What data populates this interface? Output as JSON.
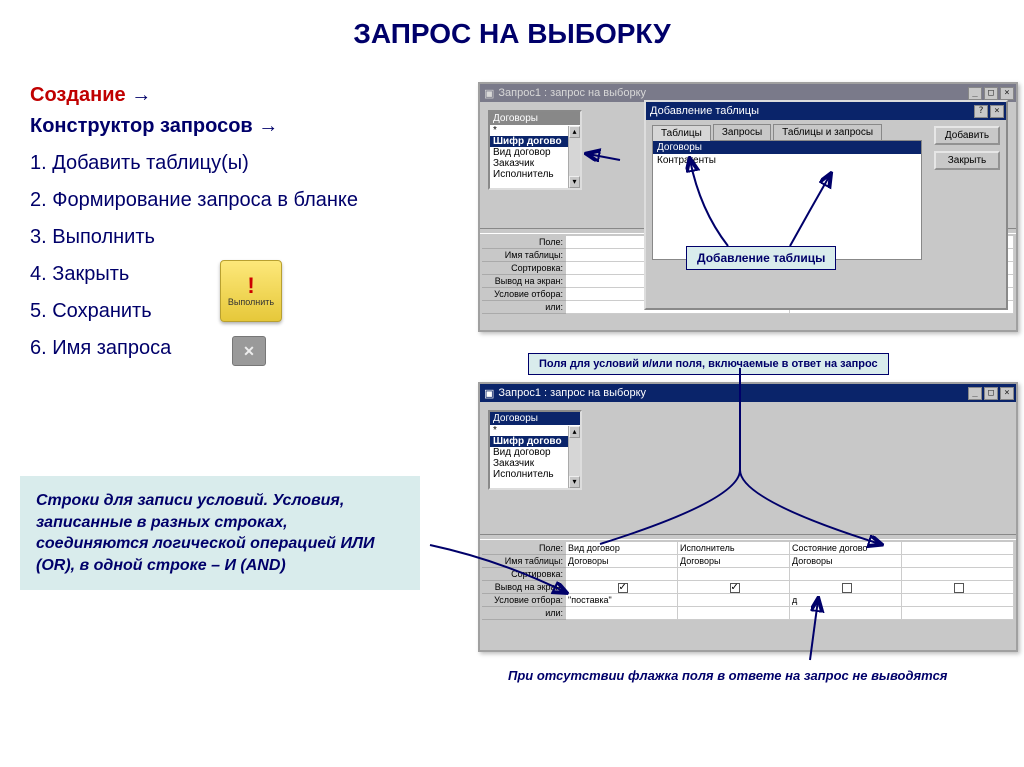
{
  "title": "ЗАПРОС НА ВЫБОРКУ",
  "left": {
    "create": "Создание",
    "arrow": "→",
    "constructor": "Конструктор запросов",
    "steps": [
      "1. Добавить таблицу(ы)",
      "2. Формирование запроса в бланке",
      "3. Выполнить",
      "4. Закрыть",
      "5. Сохранить",
      "6. Имя запроса"
    ]
  },
  "exec_label": "Выполнить",
  "note": "Строки для записи условий. Условия, записанные в разных строках, соединяются логической операцией ИЛИ (OR), в одной строке – И (AND)",
  "callouts": {
    "add_table": "Добавление таблицы",
    "fields": "Поля для условий и/или поля, включаемые в ответ на запрос"
  },
  "bottom_caption": "При отсутствии флажка поля в ответе на запрос не выводятся",
  "win1": {
    "title": "Запрос1 : запрос на выборку",
    "table_name": "Договоры",
    "fields": [
      "*",
      "Шифр догово",
      "Вид договор",
      "Заказчик",
      "Исполнитель"
    ],
    "row_labels": [
      "Поле:",
      "Имя таблицы:",
      "Сортировка:",
      "Вывод на экран:",
      "Условие отбора:",
      "или:"
    ]
  },
  "dialog": {
    "title": "Добавление таблицы",
    "tabs": [
      "Таблицы",
      "Запросы",
      "Таблицы и запросы"
    ],
    "items": [
      "Договоры",
      "Контрагенты"
    ],
    "add": "Добавить",
    "close": "Закрыть"
  },
  "win2": {
    "title": "Запрос1 : запрос на выборку",
    "table_name": "Договоры",
    "fields": [
      "*",
      "Шифр догово",
      "Вид договор",
      "Заказчик",
      "Исполнитель"
    ],
    "row_labels": [
      "Поле:",
      "Имя таблицы:",
      "Сортировка:",
      "Вывод на экран:",
      "Условие отбора:",
      "или:"
    ],
    "cols": [
      {
        "field": "Вид договор",
        "table": "Договоры",
        "show": true,
        "crit": "\"поставка\""
      },
      {
        "field": "Исполнитель",
        "table": "Договоры",
        "show": true,
        "crit": ""
      },
      {
        "field": "Состояние догово",
        "table": "Договоры",
        "show": false,
        "crit": "д"
      },
      {
        "field": "",
        "table": "",
        "show": false,
        "crit": ""
      }
    ]
  }
}
